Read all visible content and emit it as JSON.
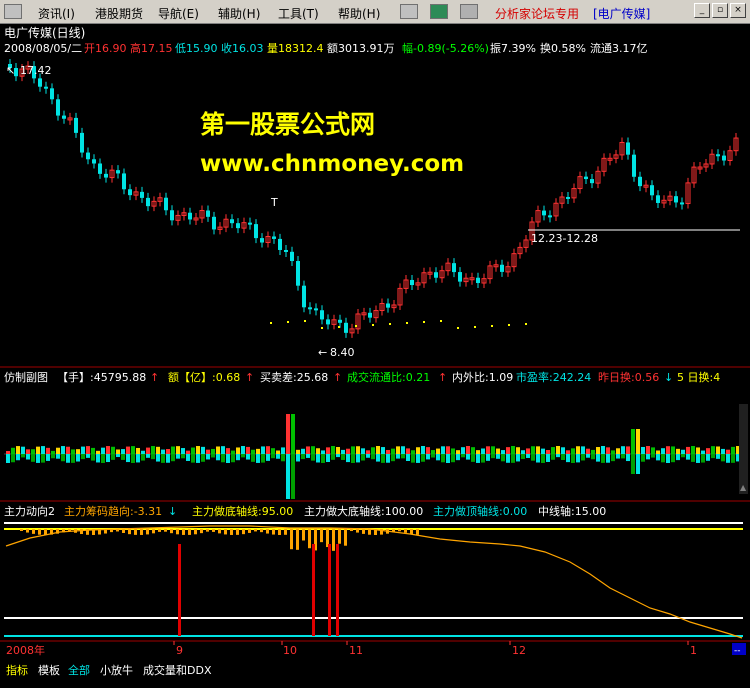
{
  "menubar": {
    "items": [
      "资讯(I)",
      "港股期货",
      "导航(E)",
      "辅助(H)",
      "工具(T)",
      "帮助(H)"
    ],
    "forum_label": "分析家论坛专用",
    "forum_stock": "[电广传媒]"
  },
  "header": {
    "title": "电广传媒(日线)",
    "date": "2008/08/05/二",
    "open": "开16.90",
    "high": "高17.15",
    "low": "低15.90",
    "close": "收16.03",
    "volume": "量18312.4",
    "amount": "额3013.91万",
    "change": "幅-0.89(-5.26%)",
    "amplitude": "振7.39%",
    "turnover": "换0.58%",
    "float": "流通3.17亿"
  },
  "watermark": {
    "line1": "第一股票公式网",
    "line2": "www.chnmoney.com"
  },
  "price_annotations": {
    "high_label": "17.42",
    "low_label": "8.40",
    "range_label": "12.23-12.28",
    "marker_t": "T"
  },
  "sub1": {
    "name": "仿制副图",
    "hand_label": "【手】:45795.88",
    "amount_label": "额【亿】:0.68",
    "diff_label": "买卖差:25.68",
    "flow_ratio": "成交流通比:0.21",
    "inout_ratio": "内外比:1.09",
    "pe": "市盈率:242.24",
    "yesterday_turnover": "昨日换:0.56",
    "five_day_turnover": "5 日换:4"
  },
  "sub2": {
    "name": "主力动向2",
    "trend": "主力筹码趋向:-3.31",
    "bottom_axis": "主力做底轴线:95.00",
    "big_bottom_axis": "主力做大底轴线:100.00",
    "top_axis": "主力做顶轴线:0.00",
    "mid_axis": "中线轴:15.00"
  },
  "timeline": {
    "labels": [
      "2008年",
      "9",
      "10",
      "11",
      "12",
      "1"
    ]
  },
  "tabs": [
    "指标",
    "模板",
    "全部",
    "小放牛",
    "成交量和DDX"
  ],
  "chart_data": {
    "type": "candlestick",
    "title": "电广传媒(日线)",
    "high_marker": 17.42,
    "low_marker": 8.4,
    "range_marker": "12.23-12.28",
    "timeline": [
      "2008年",
      "9",
      "10",
      "11",
      "12",
      "1"
    ],
    "indicator_axes": {
      "bottom_axis": 95.0,
      "big_bottom_axis": 100.0,
      "top_axis": 0.0,
      "mid_axis": 15.0
    }
  },
  "colors": {
    "up": "#ff3232",
    "down": "#00e4e4",
    "yellow": "#ffff00",
    "orange": "#ffa500"
  }
}
